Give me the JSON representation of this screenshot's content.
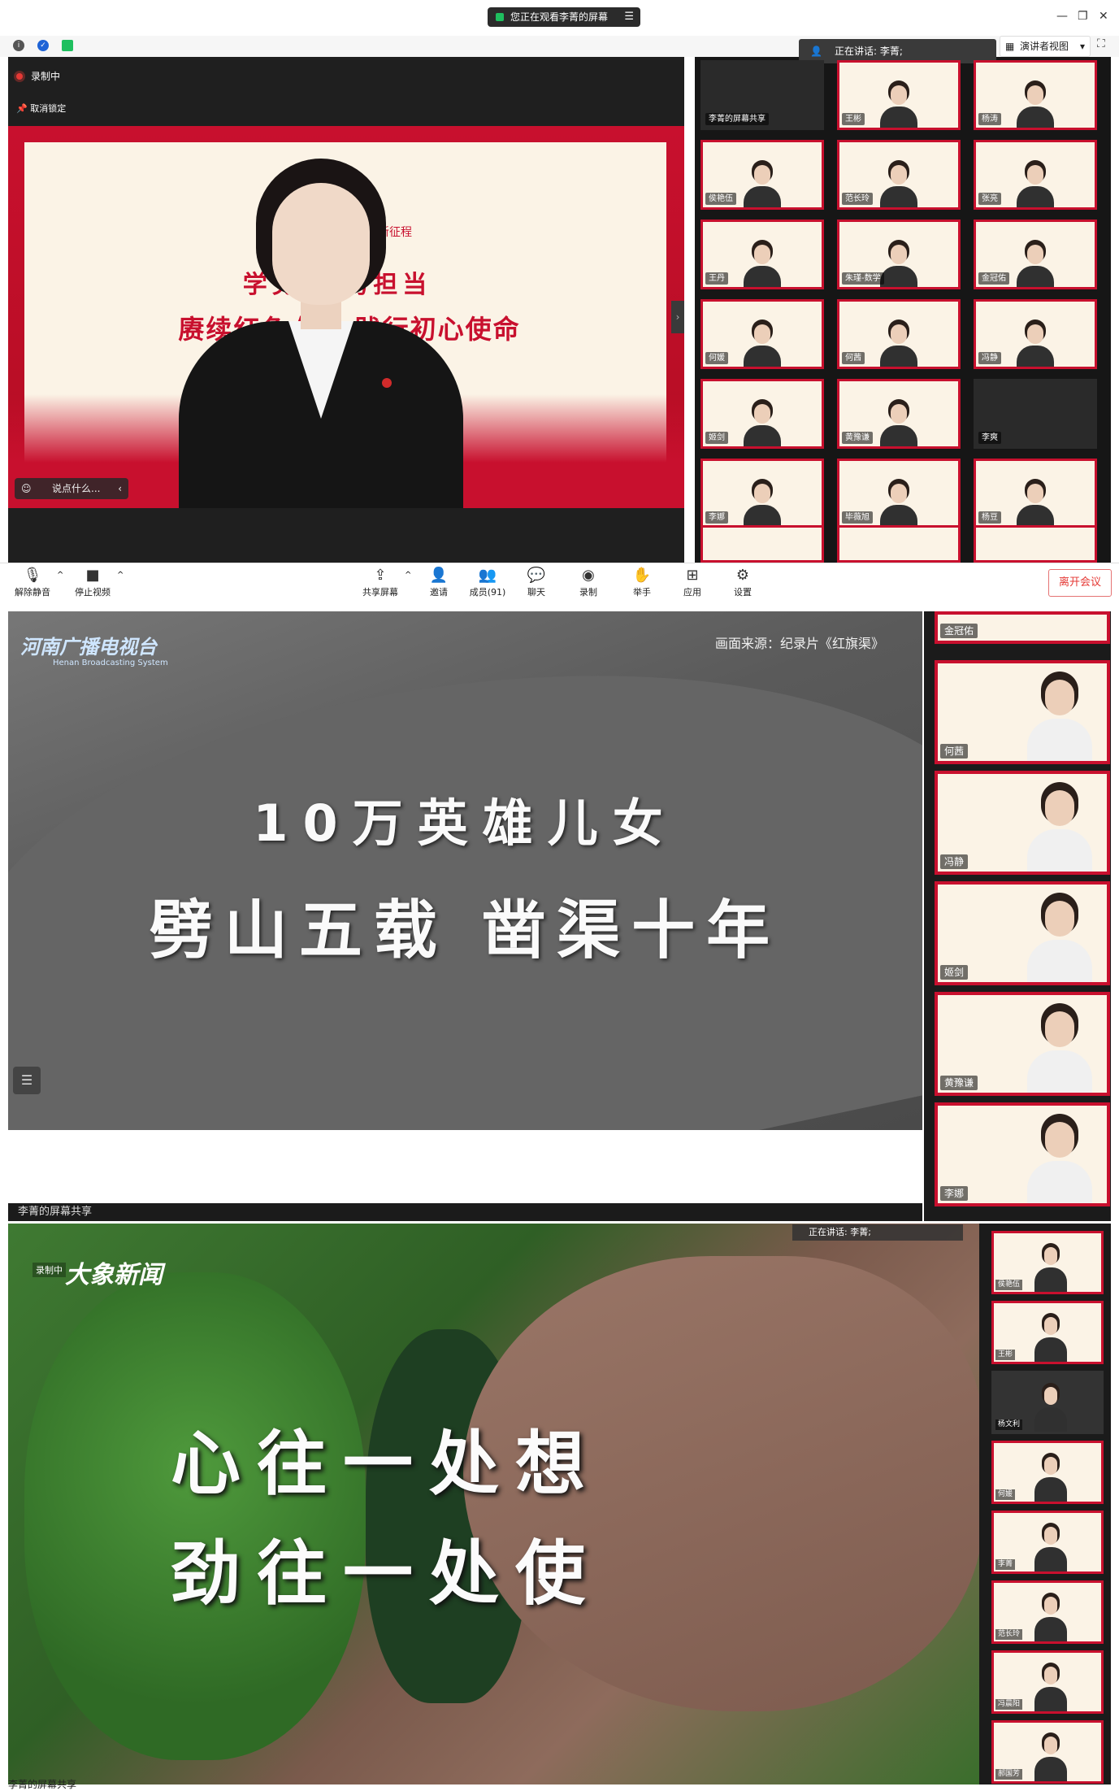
{
  "section1": {
    "share_banner": "您正在观看李菁的屏幕",
    "recording": "录制中",
    "unpin": "取消锁定",
    "speaking": "正在讲话: 李菁;",
    "view_mode": "演讲者视图",
    "slide": {
      "top": "新征程",
      "line1": "学党史  勇担当",
      "line2": "赓续红色血脉 践行初心使命"
    },
    "chat_placeholder": "说点什么...",
    "gallery": [
      {
        "name": "李菁的屏幕共享",
        "dark": true
      },
      {
        "name": "王彬"
      },
      {
        "name": "杨涛"
      },
      {
        "name": "侯艳伍"
      },
      {
        "name": "范长玲"
      },
      {
        "name": "张亮"
      },
      {
        "name": "王丹"
      },
      {
        "name": "朱瑾-数学"
      },
      {
        "name": "金冠佑"
      },
      {
        "name": "何媛"
      },
      {
        "name": "何茜"
      },
      {
        "name": "冯静"
      },
      {
        "name": "姬剑"
      },
      {
        "name": "黄豫谦"
      },
      {
        "name": "李爽",
        "dark": true
      },
      {
        "name": "李娜"
      },
      {
        "name": "毕薇旭"
      },
      {
        "name": "杨豆"
      }
    ],
    "toolbar": {
      "unmute": "解除静音",
      "stop_video": "停止视频",
      "share": "共享屏幕",
      "invite": "邀请",
      "members": "成员(91)",
      "chat": "聊天",
      "record": "录制",
      "raise_hand": "举手",
      "apps": "应用",
      "settings": "设置",
      "leave": "离开会议"
    }
  },
  "section2": {
    "logo": "河南广播电视台",
    "logo_sub": "Henan Broadcasting System",
    "source": "画面来源：纪录片《红旗渠》",
    "line1": "10万英雄儿女",
    "line2": "劈山五载 凿渠十年",
    "bottom": "李菁的屏幕共享",
    "side": [
      {
        "name": "金冠佑"
      },
      {
        "name": "何茜"
      },
      {
        "name": "冯静"
      },
      {
        "name": "姬剑"
      },
      {
        "name": "黄豫谦"
      },
      {
        "name": "李娜"
      }
    ]
  },
  "section3": {
    "recording": "录制中",
    "brand": "大象新闻",
    "speaking": "正在讲话: 李菁;",
    "line1": "心往一处想",
    "line2": "劲往一处使",
    "bottom": "李菁的屏幕共享",
    "side": [
      {
        "name": "侯艳伍"
      },
      {
        "name": "王彬"
      },
      {
        "name": "杨文利",
        "dark": true
      },
      {
        "name": "何媛"
      },
      {
        "name": "李菁"
      },
      {
        "name": "范长玲"
      },
      {
        "name": "冯晨阳"
      },
      {
        "name": "郝国芳"
      }
    ]
  }
}
